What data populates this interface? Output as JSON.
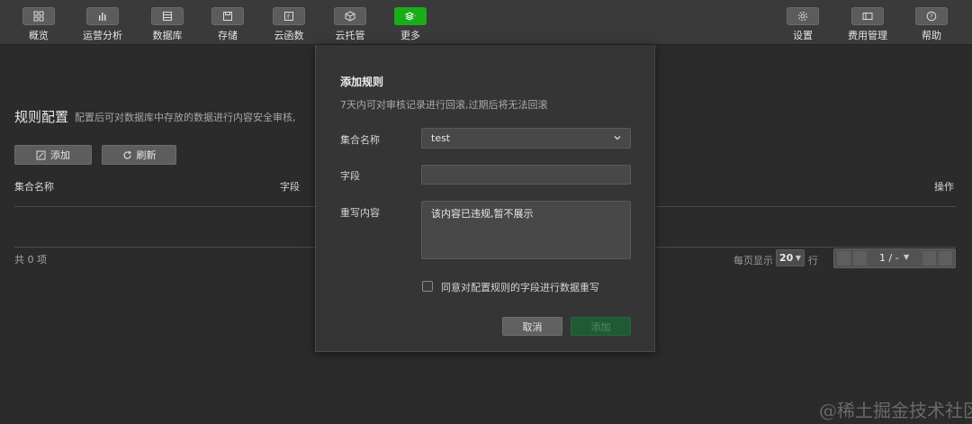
{
  "toolbar": {
    "left": [
      {
        "label": "概览",
        "icon": "grid-icon"
      },
      {
        "label": "运营分析",
        "icon": "bar-chart-icon"
      },
      {
        "label": "数据库",
        "icon": "list-icon"
      },
      {
        "label": "存储",
        "icon": "disk-icon"
      },
      {
        "label": "云函数",
        "icon": "function-icon"
      },
      {
        "label": "云托管",
        "icon": "cube-icon"
      },
      {
        "label": "更多",
        "icon": "layers-icon"
      }
    ],
    "right": [
      {
        "label": "设置",
        "icon": "gear-icon"
      },
      {
        "label": "费用管理",
        "icon": "wallet-icon"
      },
      {
        "label": "帮助",
        "icon": "help-icon"
      }
    ]
  },
  "page": {
    "title": "规则配置",
    "description": "配置后可对数据库中存放的数据进行内容安全审核,",
    "add_label": "添加",
    "refresh_label": "刷新",
    "columns": [
      "集合名称",
      "字段",
      "操作"
    ],
    "total": "共 0 项",
    "per_page_prefix": "每页显示",
    "per_page_value": "20",
    "per_page_suffix": "行",
    "page_indicator": "1 / -"
  },
  "modal": {
    "title": "添加规则",
    "subtitle": "7天内可对审核记录进行回滚,过期后将无法回滚",
    "collection_label": "集合名称",
    "collection_value": "test",
    "field_label": "字段",
    "field_value": "",
    "rewrite_label": "重写内容",
    "rewrite_value": "该内容已违规,暂不展示",
    "agree_label": "同意对配置规则的字段进行数据重写",
    "agree_checked": false,
    "cancel_label": "取消",
    "add_label": "添加"
  },
  "watermark": "@稀土掘金技术社区"
}
